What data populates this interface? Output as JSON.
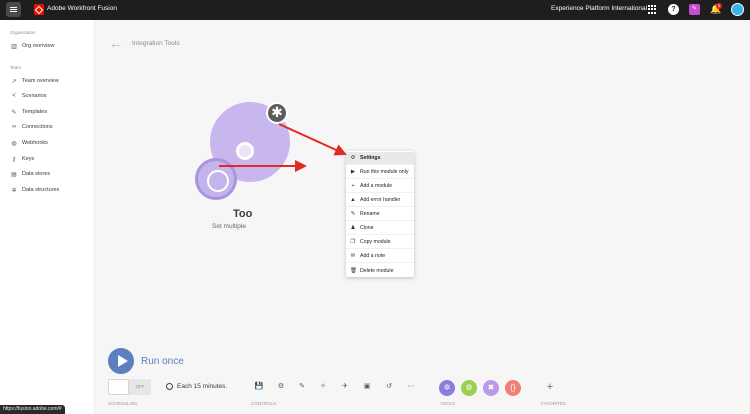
{
  "topbar": {
    "app_title": "Adobe Workfront Fusion",
    "org_name": "Experience Platform International",
    "notification_count": "1",
    "icons": [
      "menu-icon",
      "adobe-logo",
      "apps-grid-icon",
      "help-icon",
      "feedback-icon",
      "bell-icon",
      "avatar"
    ]
  },
  "sidebar": {
    "org_label": "Organization",
    "org_item": "Org overview",
    "team_label": "Team",
    "items": [
      {
        "label": "Team overview",
        "icon": "trend-icon"
      },
      {
        "label": "Scenarios",
        "icon": "share-icon"
      },
      {
        "label": "Templates",
        "icon": "template-icon"
      },
      {
        "label": "Connections",
        "icon": "link-icon"
      },
      {
        "label": "Webhooks",
        "icon": "globe-icon"
      },
      {
        "label": "Keys",
        "icon": "key-icon"
      },
      {
        "label": "Data stores",
        "icon": "database-icon"
      },
      {
        "label": "Data structures",
        "icon": "structure-icon"
      }
    ]
  },
  "main": {
    "scenario_title": "Integration Tools",
    "module_name": "Too",
    "module_subtitle": "Set multiple"
  },
  "context_menu": {
    "items": [
      {
        "label": "Settings",
        "icon": "gear-icon"
      },
      {
        "label": "Run this module only",
        "icon": "play-icon"
      },
      {
        "label": "Add a module",
        "icon": "plus-icon"
      },
      {
        "label": "Add error handler",
        "icon": "warning-icon"
      },
      {
        "label": "Rename",
        "icon": "pencil-icon"
      },
      {
        "label": "Clone",
        "icon": "clone-icon"
      },
      {
        "label": "Copy module",
        "icon": "copy-icon"
      },
      {
        "label": "Add a note",
        "icon": "note-icon"
      },
      {
        "label": "Delete module",
        "icon": "trash-icon"
      }
    ]
  },
  "bottom": {
    "run_label": "Run once",
    "toggle_state": "OFF",
    "schedule": "Each 15 minutes.",
    "groups": {
      "scheduling": "SCHEDULING",
      "controls": "CONTROLS",
      "tools": "TOOLS",
      "favorites": "FAVORITES"
    },
    "tool_colors": [
      "#8b7ce0",
      "#9bcf4f",
      "#b99ae6",
      "#f07f74"
    ]
  },
  "status_url": "https://fusion.adobe.com/#",
  "colors": {
    "accent": "#5b7fc0",
    "arrow": "#e02b1e",
    "module": "#c8b6ee"
  }
}
